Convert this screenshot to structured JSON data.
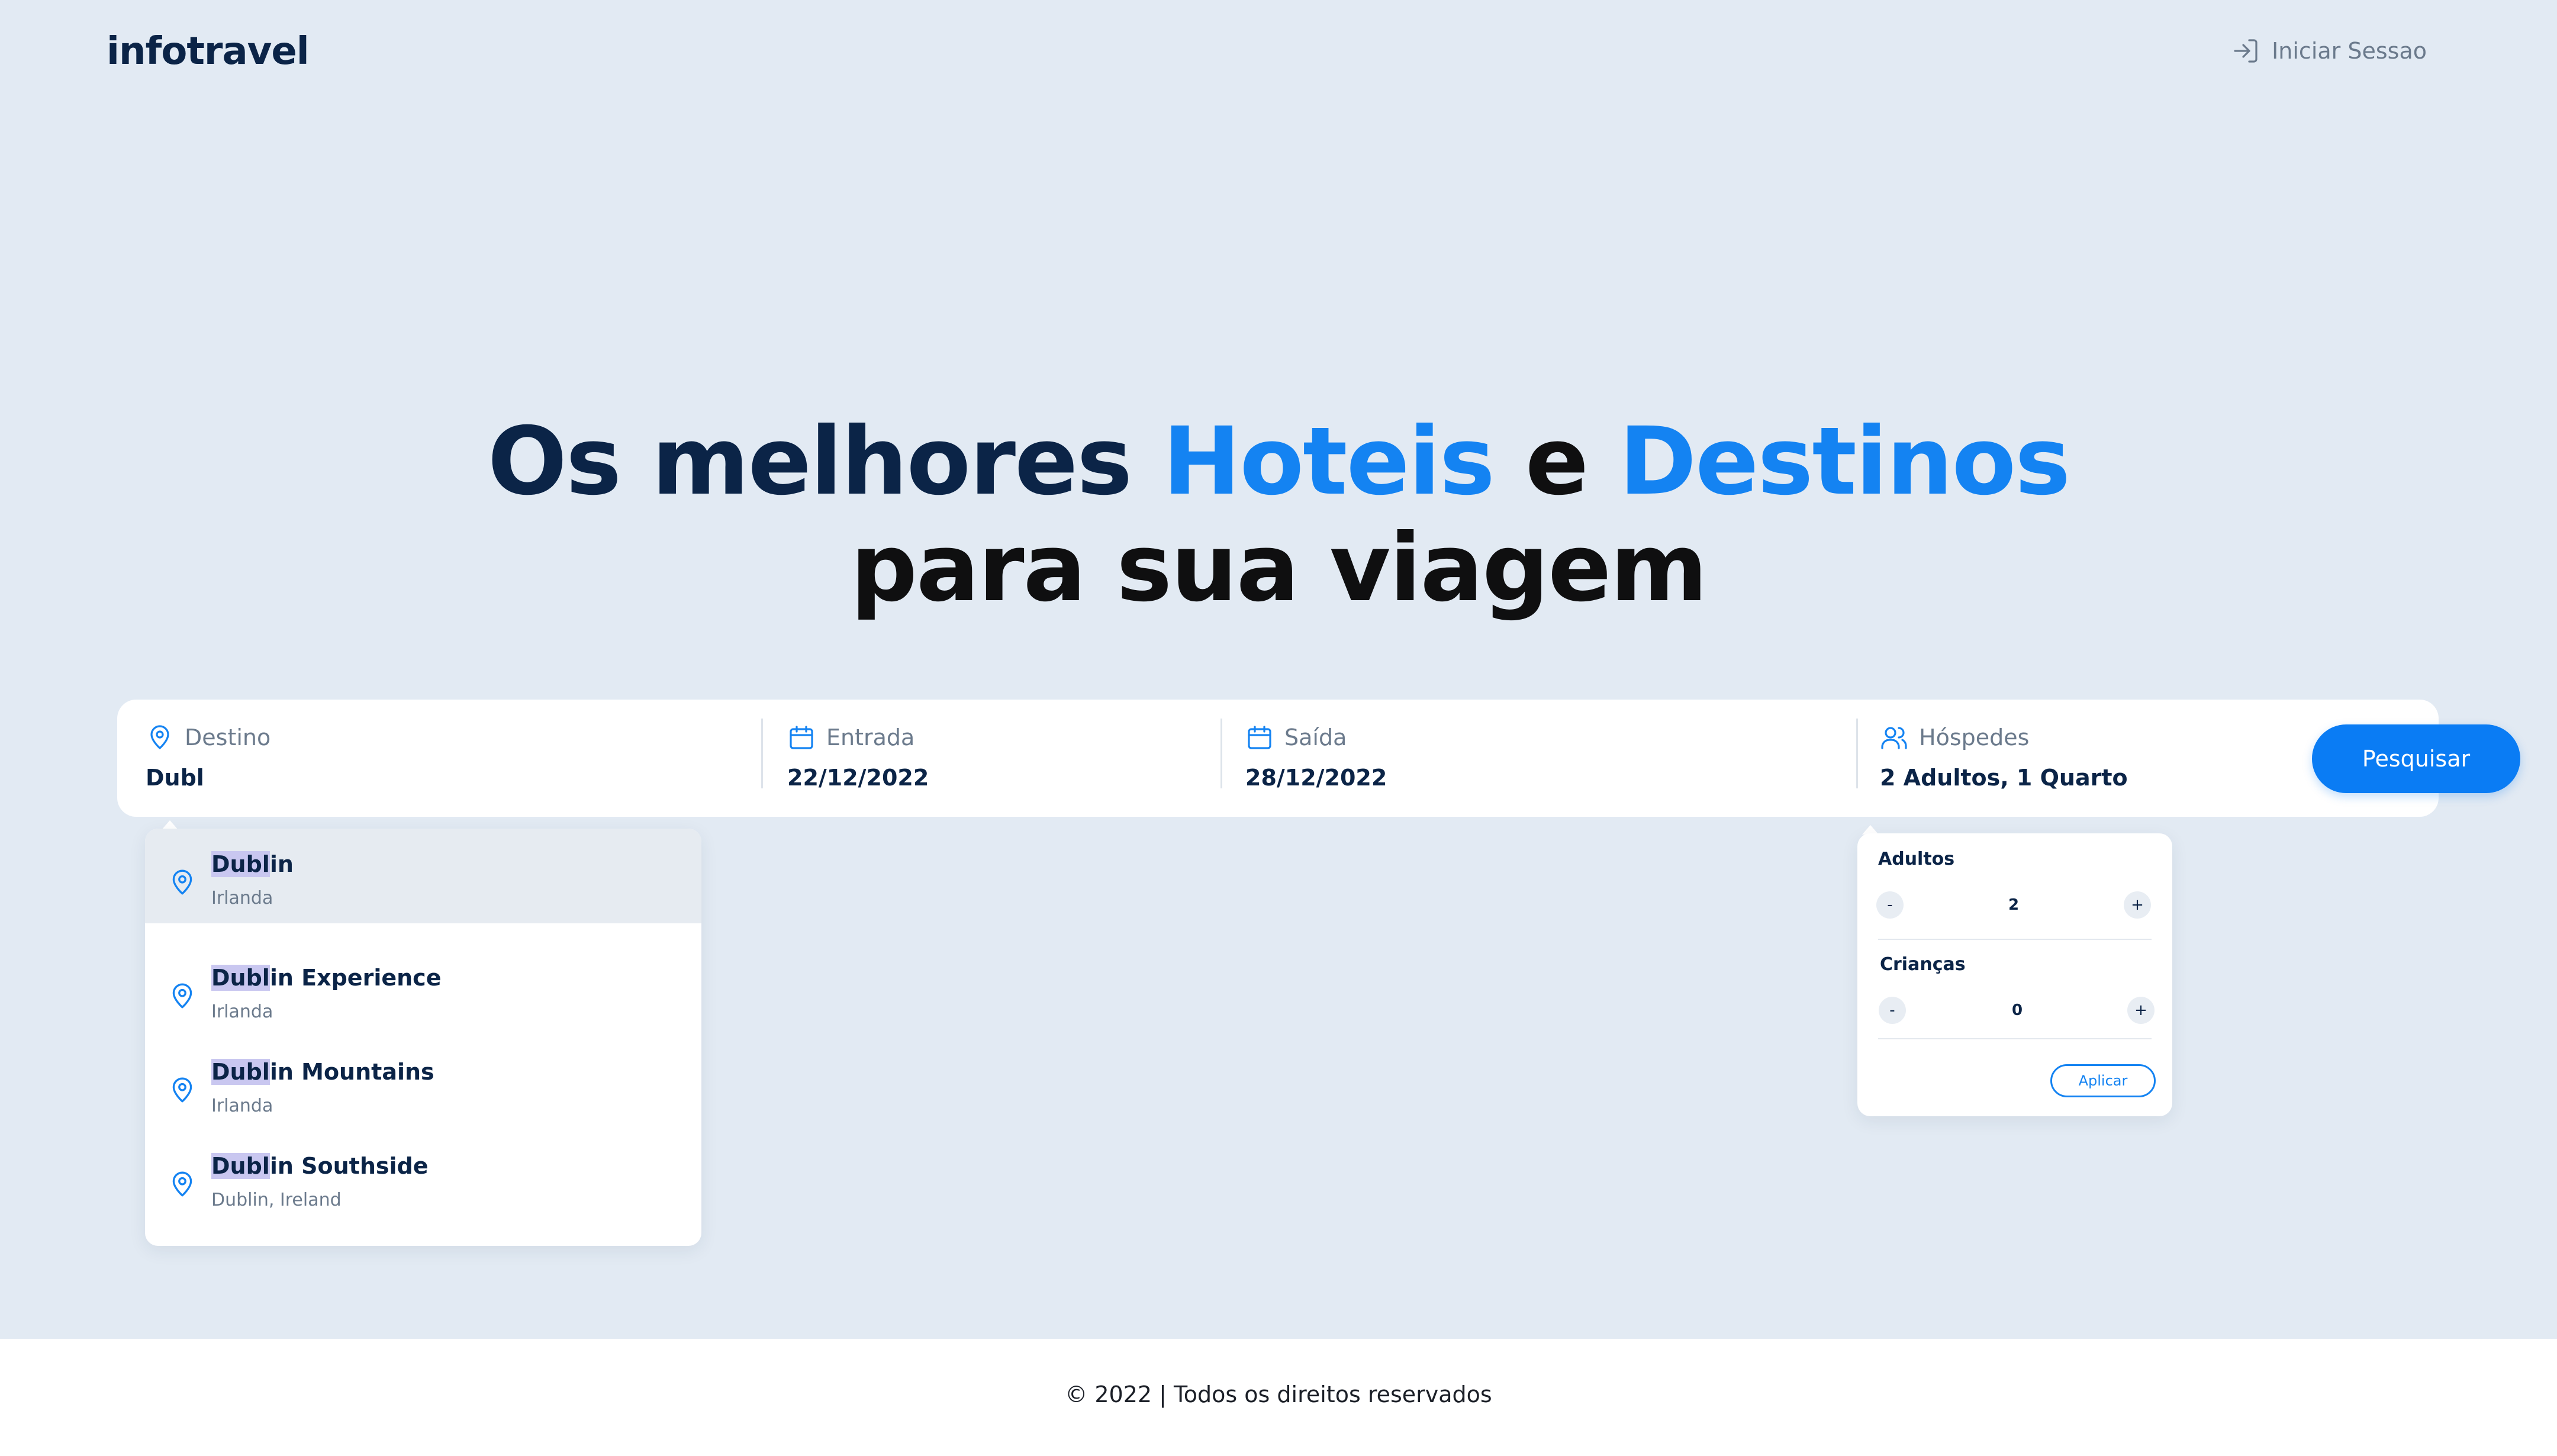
{
  "header": {
    "logo": "infotravel",
    "login_label": "Iniciar Sessao"
  },
  "hero": {
    "line1_part1": "Os melhores ",
    "line1_highlight1": "Hoteis",
    "line1_part2": " e ",
    "line1_highlight2": "Destinos",
    "line2": "para sua viagem"
  },
  "search": {
    "destino": {
      "label": "Destino",
      "value": "Dubl"
    },
    "entrada": {
      "label": "Entrada",
      "value": "22/12/2022"
    },
    "saida": {
      "label": "Saída",
      "value": "28/12/2022"
    },
    "hospedes": {
      "label": "Hóspedes",
      "value": "2 Adultos, 1 Quarto"
    },
    "button_label": "Pesquisar"
  },
  "suggestions": [
    {
      "match": "Dubl",
      "rest": "in",
      "sub": "Irlanda"
    },
    {
      "match": "Dubl",
      "rest": "in Experience",
      "sub": "Irlanda"
    },
    {
      "match": "Dubl",
      "rest": "in Mountains",
      "sub": "Irlanda"
    },
    {
      "match": "Dubl",
      "rest": "in Southside",
      "sub": "Dublin, Ireland"
    }
  ],
  "guests": {
    "adultos_label": "Adultos",
    "adultos_value": "2",
    "criancas_label": "Crianças",
    "criancas_value": "0",
    "minus": "-",
    "plus": "+",
    "apply_label": "Aplicar"
  },
  "footer": {
    "copyright": "© 2022 | Todos os direitos reservados"
  },
  "colors": {
    "background": "#e2eaf3",
    "brand_dark": "#0b2447",
    "accent_blue": "#1483f2",
    "button_blue": "#0a7cf4",
    "highlight": "#c9c7f0"
  },
  "icons": {
    "login": "login-arrow-icon",
    "destino": "map-pin-icon",
    "calendar": "calendar-icon",
    "guests": "users-icon"
  }
}
